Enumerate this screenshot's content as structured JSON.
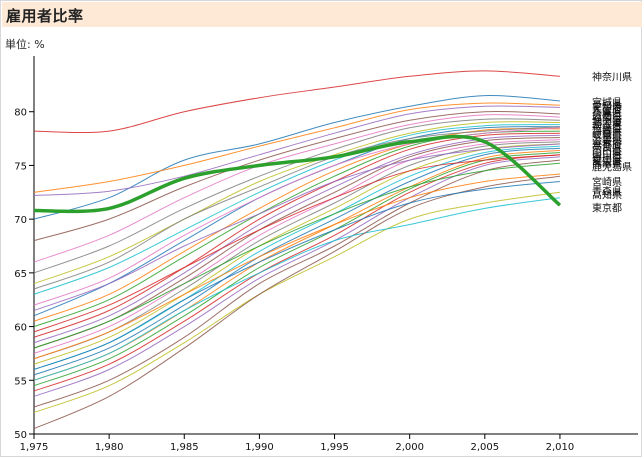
{
  "header": {
    "title": "雇用者比率"
  },
  "unit": "単位: %",
  "chart_data": {
    "type": "line",
    "title": "雇用者比率",
    "unit": "%",
    "xlim": [
      1975,
      2012
    ],
    "ylim": [
      50,
      85
    ],
    "x_ticks": [
      1975,
      1980,
      1985,
      1990,
      1995,
      2000,
      2005,
      2010
    ],
    "x_tick_labels": [
      "1,975",
      "1,980",
      "1,985",
      "1,990",
      "1,995",
      "2,000",
      "2,005",
      "2,010"
    ],
    "y_ticks": [
      50,
      55,
      60,
      65,
      70,
      75,
      80
    ],
    "x": [
      1975,
      1980,
      1985,
      1990,
      1995,
      2000,
      2005,
      2010
    ],
    "highlight": {
      "name": "東京都",
      "color": "#2ca02c",
      "values": [
        70.8,
        71.0,
        73.8,
        75.0,
        75.8,
        77.2,
        77.2,
        71.3
      ]
    },
    "series": [
      {
        "name": "神奈川県",
        "color": "#d62728",
        "values": [
          78.2,
          78.2,
          80.0,
          81.3,
          82.3,
          83.3,
          83.8,
          83.3
        ]
      },
      {
        "color": "#1f77b4",
        "values": [
          70.0,
          72.0,
          75.5,
          77.0,
          79.0,
          80.5,
          81.5,
          81.0
        ]
      },
      {
        "color": "#ff7f0e",
        "values": [
          72.5,
          73.5,
          75.0,
          76.8,
          78.5,
          80.2,
          80.8,
          80.6
        ]
      },
      {
        "color": "#9467bd",
        "values": [
          72.2,
          72.6,
          74.0,
          76.0,
          78.0,
          79.8,
          80.5,
          80.4
        ]
      },
      {
        "color": "#8c564b",
        "values": [
          68.0,
          70.0,
          73.0,
          75.5,
          77.5,
          79.2,
          80.0,
          79.8
        ]
      },
      {
        "color": "#e377c2",
        "values": [
          66.0,
          68.5,
          72.0,
          75.0,
          77.0,
          78.8,
          79.7,
          79.5
        ]
      },
      {
        "color": "#7f7f7f",
        "values": [
          65.0,
          67.5,
          71.0,
          74.0,
          76.5,
          78.5,
          79.3,
          79.2
        ]
      },
      {
        "color": "#bcbd22",
        "values": [
          64.0,
          66.5,
          70.0,
          73.5,
          76.0,
          78.0,
          79.0,
          79.0
        ]
      },
      {
        "color": "#17becf",
        "values": [
          63.0,
          65.5,
          69.0,
          72.5,
          75.5,
          77.8,
          78.7,
          78.8
        ]
      },
      {
        "color": "#1f77b4",
        "values": [
          61.0,
          64.0,
          68.0,
          72.0,
          75.0,
          77.5,
          78.5,
          78.6
        ]
      },
      {
        "color": "#ff7f0e",
        "values": [
          60.5,
          63.0,
          67.0,
          71.0,
          74.5,
          77.0,
          78.3,
          78.4
        ]
      },
      {
        "color": "#2ca02c",
        "values": [
          60.0,
          62.5,
          66.5,
          70.5,
          74.0,
          76.8,
          78.0,
          78.2
        ]
      },
      {
        "color": "#d62728",
        "values": [
          59.0,
          61.5,
          65.5,
          70.0,
          73.5,
          76.5,
          77.8,
          78.0
        ]
      },
      {
        "color": "#9467bd",
        "values": [
          58.5,
          61.0,
          65.0,
          69.5,
          73.0,
          76.0,
          77.5,
          77.8
        ]
      },
      {
        "color": "#8c564b",
        "values": [
          58.0,
          60.5,
          64.5,
          69.0,
          72.5,
          75.8,
          77.3,
          77.6
        ]
      },
      {
        "color": "#e377c2",
        "values": [
          57.5,
          60.0,
          64.0,
          68.5,
          72.0,
          75.5,
          77.0,
          77.4
        ]
      },
      {
        "color": "#7f7f7f",
        "values": [
          57.0,
          59.5,
          63.5,
          68.0,
          71.5,
          75.0,
          76.8,
          77.2
        ]
      },
      {
        "color": "#bcbd22",
        "values": [
          56.5,
          59.0,
          63.0,
          67.5,
          71.0,
          74.5,
          76.5,
          77.0
        ]
      },
      {
        "color": "#17becf",
        "values": [
          56.0,
          58.5,
          62.5,
          67.0,
          70.5,
          74.0,
          76.2,
          76.8
        ]
      },
      {
        "color": "#1f77b4",
        "values": [
          55.5,
          58.0,
          62.0,
          66.5,
          70.0,
          73.5,
          76.0,
          76.6
        ]
      },
      {
        "color": "#ff7f0e",
        "values": [
          55.0,
          57.5,
          61.5,
          66.0,
          69.5,
          73.0,
          75.7,
          76.4
        ]
      },
      {
        "color": "#2ca02c",
        "values": [
          54.5,
          57.0,
          61.0,
          65.5,
          69.0,
          72.8,
          75.5,
          76.2
        ]
      },
      {
        "color": "#d62728",
        "values": [
          54.0,
          56.5,
          60.5,
          65.0,
          68.5,
          72.5,
          75.2,
          76.0
        ]
      },
      {
        "color": "#9467bd",
        "values": [
          53.5,
          56.0,
          60.0,
          64.5,
          68.0,
          72.0,
          75.0,
          75.8
        ]
      },
      {
        "color": "#8c564b",
        "values": [
          52.5,
          55.0,
          59.0,
          64.0,
          67.5,
          71.5,
          74.5,
          75.5
        ]
      },
      {
        "color": "#e377c2",
        "values": [
          62.0,
          64.5,
          68.5,
          72.0,
          75.0,
          77.0,
          78.0,
          78.5
        ]
      },
      {
        "color": "#7f7f7f",
        "values": [
          63.5,
          66.0,
          70.0,
          73.0,
          75.8,
          77.5,
          78.2,
          78.6
        ]
      },
      {
        "color": "#bcbd22",
        "values": [
          52.0,
          54.5,
          58.5,
          63.0,
          66.5,
          70.0,
          71.5,
          72.5
        ]
      },
      {
        "color": "#17becf",
        "values": [
          55.0,
          57.5,
          61.5,
          65.0,
          68.0,
          69.5,
          71.0,
          72.0
        ]
      },
      {
        "color": "#8c564b",
        "values": [
          50.5,
          53.5,
          58.0,
          63.0,
          67.0,
          71.0,
          73.0,
          74.0
        ]
      },
      {
        "color": "#1f77b4",
        "values": [
          56.0,
          58.5,
          62.5,
          66.0,
          69.0,
          71.5,
          72.8,
          73.5
        ]
      },
      {
        "color": "#ff7f0e",
        "values": [
          57.0,
          59.5,
          63.0,
          66.5,
          69.5,
          72.0,
          73.5,
          74.2
        ]
      },
      {
        "color": "#d62728",
        "values": [
          59.5,
          62.0,
          65.5,
          69.0,
          72.0,
          74.5,
          75.5,
          76.0
        ]
      },
      {
        "color": "#9467bd",
        "values": [
          61.5,
          64.0,
          67.5,
          70.5,
          73.5,
          75.5,
          76.5,
          77.0
        ]
      },
      {
        "color": "#2ca02c",
        "values": [
          58.0,
          60.5,
          64.0,
          67.5,
          70.5,
          73.0,
          74.5,
          75.2
        ]
      }
    ],
    "right_labels": [
      {
        "text": "神奈川県",
        "y": 83.3
      },
      {
        "text": "宮城県",
        "y": 80.9
      },
      {
        "text": "愛知県",
        "y": 80.6
      },
      {
        "text": "大阪府",
        "y": 80.3
      },
      {
        "text": "兵庫県",
        "y": 80.0
      },
      {
        "text": "広島県",
        "y": 79.7
      },
      {
        "text": "福岡県",
        "y": 79.4
      },
      {
        "text": "北海道",
        "y": 79.1
      },
      {
        "text": "埼玉県",
        "y": 78.8
      },
      {
        "text": "千葉県",
        "y": 78.5
      },
      {
        "text": "静岡県",
        "y": 78.2
      },
      {
        "text": "岐阜県",
        "y": 77.9
      },
      {
        "text": "三重県",
        "y": 77.6
      },
      {
        "text": "滋賀県",
        "y": 77.3
      },
      {
        "text": "京都府",
        "y": 77.0
      },
      {
        "text": "奈良県",
        "y": 76.7
      },
      {
        "text": "岡山県",
        "y": 76.4
      },
      {
        "text": "山口県",
        "y": 76.1
      },
      {
        "text": "香川県",
        "y": 75.8
      },
      {
        "text": "愛媛県",
        "y": 75.5
      },
      {
        "text": "熊本県",
        "y": 75.2
      },
      {
        "text": "鹿児島県",
        "y": 74.9
      },
      {
        "text": "宮崎県",
        "y": 73.5
      },
      {
        "text": "青森県",
        "y": 72.6
      },
      {
        "text": "高知県",
        "y": 72.3
      },
      {
        "text": "東京都",
        "y": 71.1
      }
    ]
  }
}
